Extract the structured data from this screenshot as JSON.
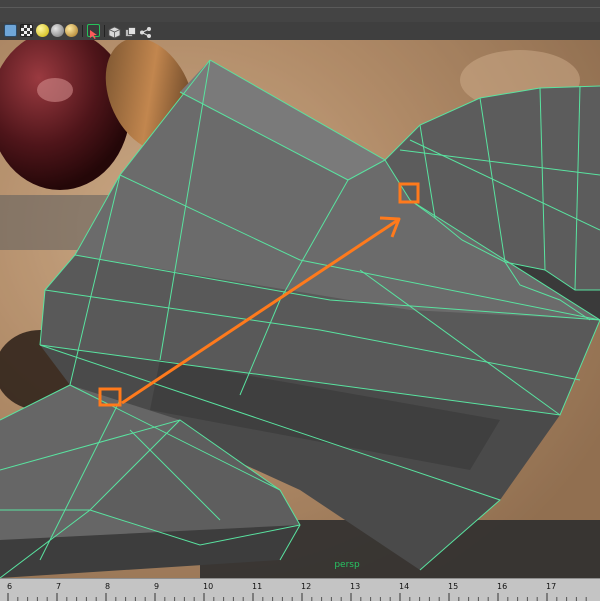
{
  "toolbar": {
    "icons": [
      {
        "name": "cube-wireframe-icon"
      },
      {
        "name": "checker-icon"
      },
      {
        "name": "light-yellow-icon"
      },
      {
        "name": "light-grey-icon"
      },
      {
        "name": "sphere-shaded-icon"
      },
      {
        "name": "select-cursor-icon"
      },
      {
        "name": "cube-solid-icon"
      },
      {
        "name": "copy-layers-icon"
      },
      {
        "name": "node-graph-icon"
      }
    ]
  },
  "viewport": {
    "panel_label": "persp",
    "wireframe_color": "#59e3a0",
    "highlight_color": "#ff7a1c"
  },
  "timeline": {
    "ticks": [
      "6",
      "7",
      "8",
      "9",
      "10",
      "11",
      "12",
      "13",
      "14",
      "15",
      "16",
      "17"
    ]
  }
}
